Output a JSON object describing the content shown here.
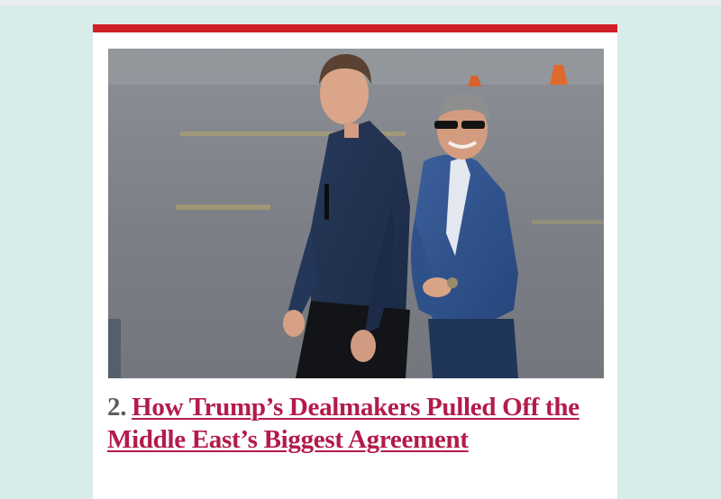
{
  "colors": {
    "page_background": "#d8ecea",
    "accent_bar": "#d11f26",
    "link": "#b31b4a",
    "number": "#5e5e5e"
  },
  "article": {
    "number": "2.",
    "headline": "How Trump’s Dealmakers Pulled Off the Middle East’s Biggest Agreement"
  }
}
